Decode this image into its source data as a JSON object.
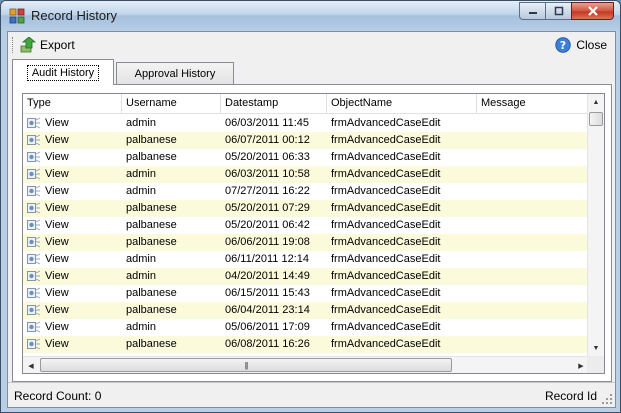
{
  "window": {
    "title": "Record History",
    "icon": "app-grid-icon",
    "controls": {
      "minimize": "minimize-icon",
      "maximize": "maximize-icon",
      "close": "close-x-icon"
    }
  },
  "toolbar": {
    "export_label": "Export",
    "export_icon": "export-arrow-icon",
    "help_icon": "help-icon",
    "close_label": "Close"
  },
  "tabs": [
    {
      "label": "Audit History",
      "active": true
    },
    {
      "label": "Approval History",
      "active": false
    }
  ],
  "grid": {
    "columns": [
      "Type",
      "Username",
      "Datestamp",
      "ObjectName",
      "Message"
    ],
    "rows": [
      {
        "type": "View",
        "username": "admin",
        "datestamp": "06/03/2011 11:45",
        "object": "frmAdvancedCaseEdit",
        "message": ""
      },
      {
        "type": "View",
        "username": "palbanese",
        "datestamp": "06/07/2011 00:12",
        "object": "frmAdvancedCaseEdit",
        "message": ""
      },
      {
        "type": "View",
        "username": "palbanese",
        "datestamp": "05/20/2011 06:33",
        "object": "frmAdvancedCaseEdit",
        "message": ""
      },
      {
        "type": "View",
        "username": "admin",
        "datestamp": "06/03/2011 10:58",
        "object": "frmAdvancedCaseEdit",
        "message": ""
      },
      {
        "type": "View",
        "username": "admin",
        "datestamp": "07/27/2011 16:22",
        "object": "frmAdvancedCaseEdit",
        "message": ""
      },
      {
        "type": "View",
        "username": "palbanese",
        "datestamp": "05/20/2011 07:29",
        "object": "frmAdvancedCaseEdit",
        "message": ""
      },
      {
        "type": "View",
        "username": "palbanese",
        "datestamp": "05/20/2011 06:42",
        "object": "frmAdvancedCaseEdit",
        "message": ""
      },
      {
        "type": "View",
        "username": "palbanese",
        "datestamp": "06/06/2011 19:08",
        "object": "frmAdvancedCaseEdit",
        "message": ""
      },
      {
        "type": "View",
        "username": "admin",
        "datestamp": "06/11/2011 12:14",
        "object": "frmAdvancedCaseEdit",
        "message": ""
      },
      {
        "type": "View",
        "username": "admin",
        "datestamp": "04/20/2011 14:49",
        "object": "frmAdvancedCaseEdit",
        "message": ""
      },
      {
        "type": "View",
        "username": "palbanese",
        "datestamp": "06/15/2011 15:43",
        "object": "frmAdvancedCaseEdit",
        "message": ""
      },
      {
        "type": "View",
        "username": "palbanese",
        "datestamp": "06/04/2011 23:14",
        "object": "frmAdvancedCaseEdit",
        "message": ""
      },
      {
        "type": "View",
        "username": "admin",
        "datestamp": "05/06/2011 17:09",
        "object": "frmAdvancedCaseEdit",
        "message": ""
      },
      {
        "type": "View",
        "username": "palbanese",
        "datestamp": "06/08/2011 16:26",
        "object": "frmAdvancedCaseEdit",
        "message": ""
      }
    ],
    "row_icon": "view-eye-icon",
    "alt_row_color": "#fbfbdc"
  },
  "statusbar": {
    "record_count": "Record Count: 0",
    "record_id": "Record Id"
  }
}
